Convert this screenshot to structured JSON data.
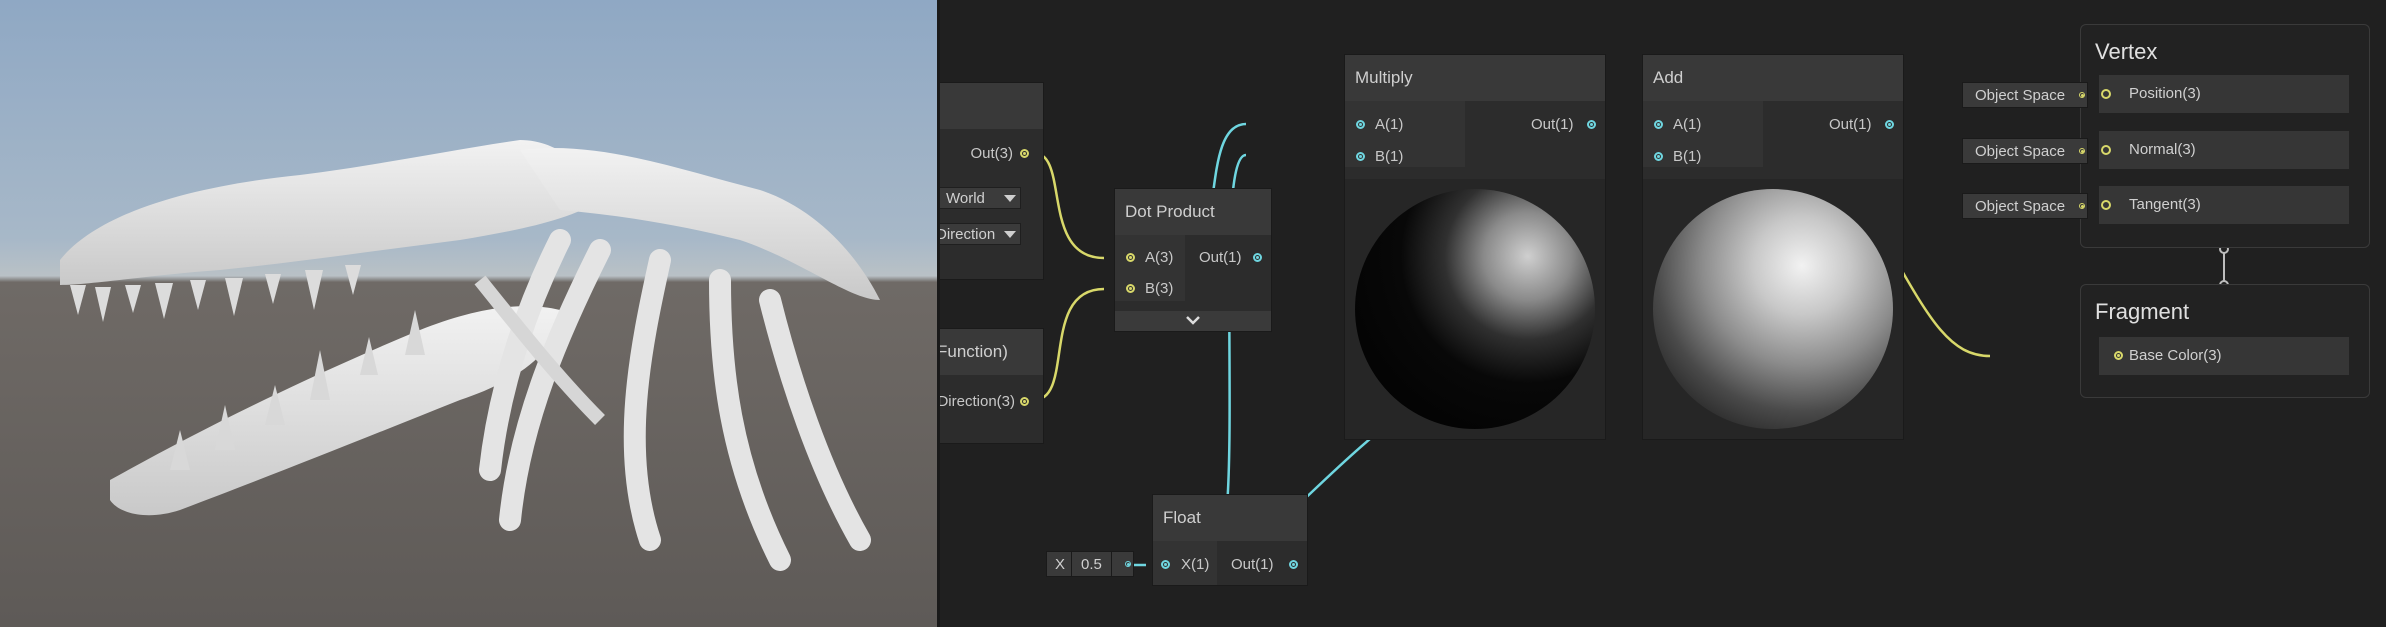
{
  "nodes": {
    "partial_top": {
      "out_label": "Out(3)",
      "dropdown1": "World",
      "dropdown2": "Direction"
    },
    "partial_bottom": {
      "title": "Function)",
      "out_label": "Direction(3)"
    },
    "dot_product": {
      "title": "Dot Product",
      "in_a": "A(3)",
      "in_b": "B(3)",
      "out": "Out(1)"
    },
    "multiply": {
      "title": "Multiply",
      "in_a": "A(1)",
      "in_b": "B(1)",
      "out": "Out(1)"
    },
    "add": {
      "title": "Add",
      "in_a": "A(1)",
      "in_b": "B(1)",
      "out": "Out(1)"
    },
    "float": {
      "title": "Float",
      "in_x": "X(1)",
      "out": "Out(1)",
      "field_label": "X",
      "field_value": "0.5"
    }
  },
  "master": {
    "vertex": {
      "title": "Vertex",
      "blocks": [
        {
          "label": "Position(3)",
          "space": "Object Space"
        },
        {
          "label": "Normal(3)",
          "space": "Object Space"
        },
        {
          "label": "Tangent(3)",
          "space": "Object Space"
        }
      ]
    },
    "fragment": {
      "title": "Fragment",
      "blocks": [
        {
          "label": "Base Color(3)"
        }
      ]
    }
  },
  "colors": {
    "vector_wire": "#d8d86a",
    "float_wire": "#6fd6e0",
    "background": "#202020"
  }
}
